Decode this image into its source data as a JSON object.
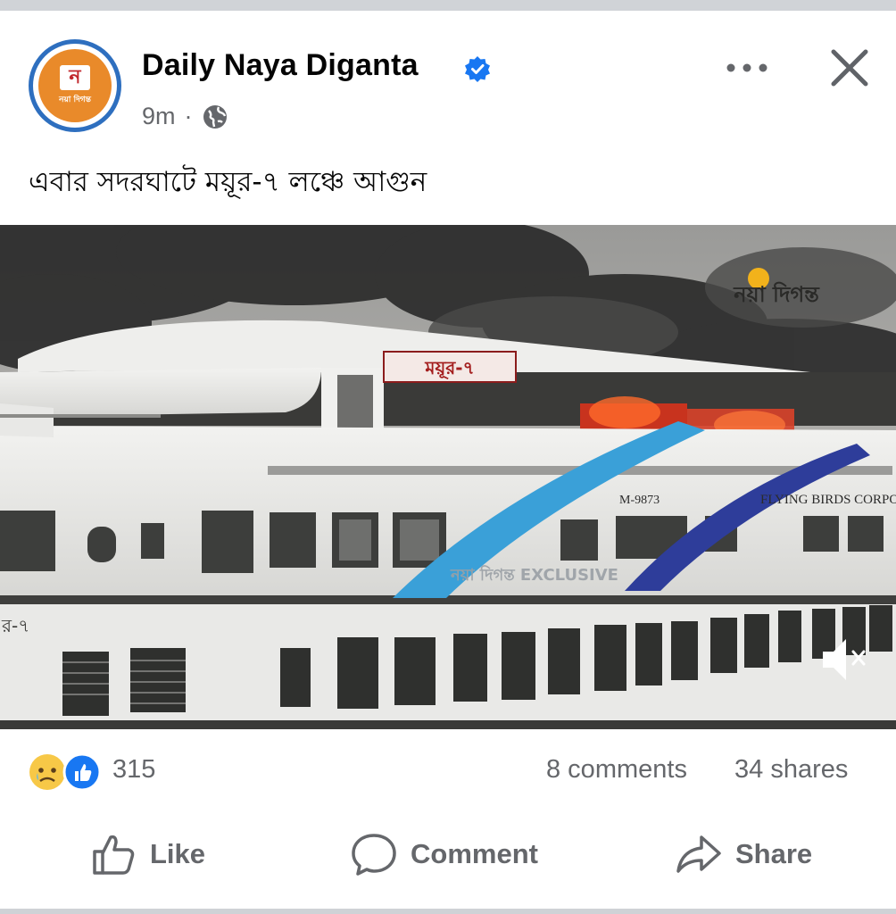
{
  "post": {
    "page_name": "Daily Naya Diganta",
    "time": "9m",
    "separator": "·",
    "text": "এবার সদরঘাটে ময়ূর-৭ লঞ্চে আগুন"
  },
  "avatar": {
    "letter": "ন",
    "label": "নয়া দিগন্ত"
  },
  "media": {
    "watermark": "নয়া দিগন্ত",
    "nameplate": "ময়ূর-৭",
    "hull_code": "M-9873",
    "company_text": "FLYING BIRDS CORPO",
    "banner_text": "নয়া দিগন্ত EXCLUSIVE",
    "stern_text": "র-৭"
  },
  "stats": {
    "reaction_count": "315",
    "comments": "8 comments",
    "shares": "34 shares"
  },
  "actions": {
    "like": "Like",
    "comment": "Comment",
    "share": "Share"
  },
  "icons": {
    "verified": "verified-badge-icon",
    "globe": "globe-icon",
    "more": "more-options-icon",
    "close": "close-icon",
    "sad": "sad-reaction-icon",
    "like_reaction": "like-reaction-icon",
    "mute": "mute-icon"
  },
  "colors": {
    "verified": "#1877f2",
    "text_secondary": "#65676b",
    "avatar_ring": "#2e6fbf"
  }
}
